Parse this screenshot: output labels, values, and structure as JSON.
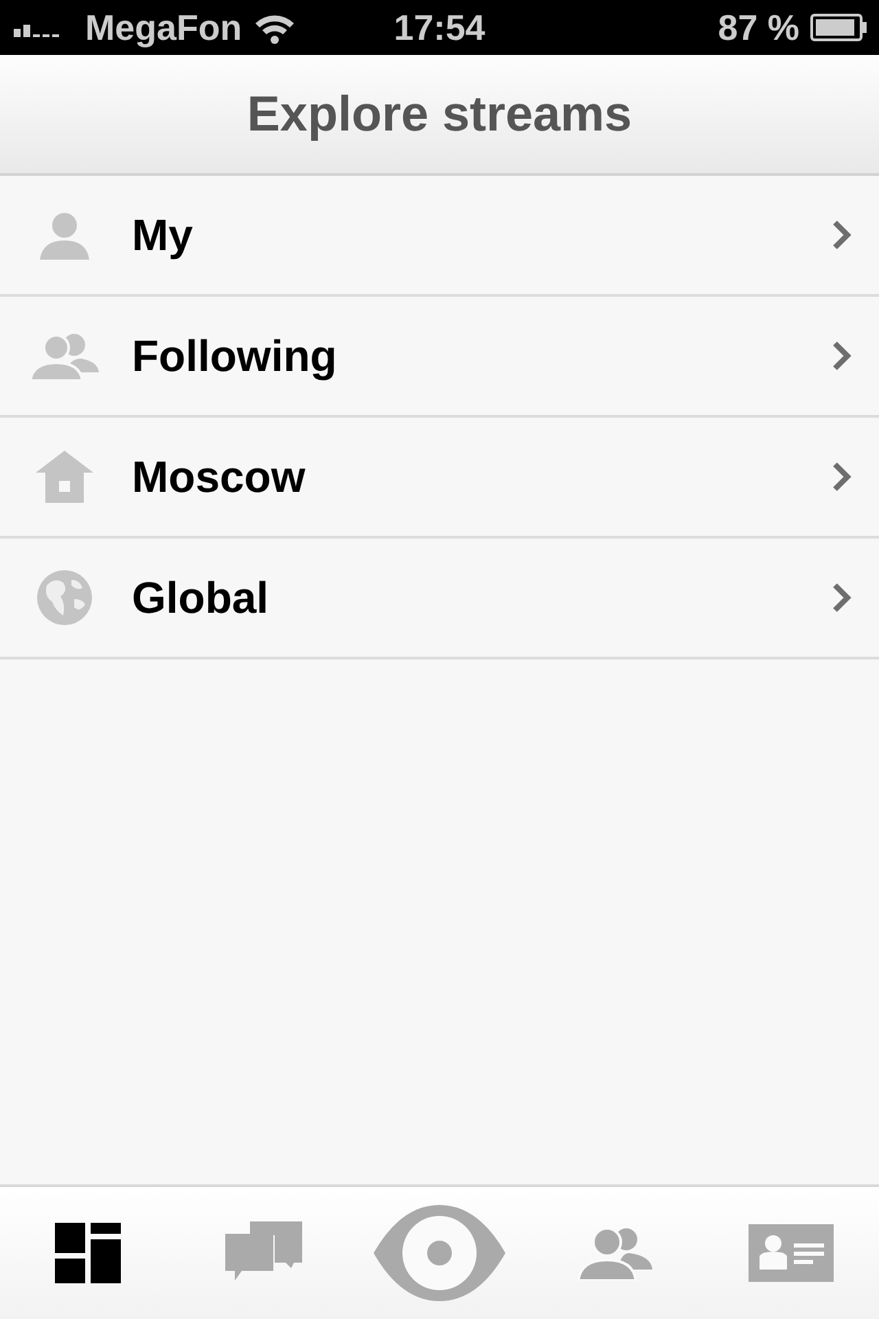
{
  "status_bar": {
    "carrier": "MegaFon",
    "time": "17:54",
    "battery": "87 %"
  },
  "title": "Explore streams",
  "items": [
    {
      "kind": "person",
      "label": "My"
    },
    {
      "kind": "people",
      "label": "Following"
    },
    {
      "kind": "home",
      "label": "Moscow"
    },
    {
      "kind": "globe",
      "label": "Global"
    }
  ],
  "tabs": [
    {
      "kind": "dashboard",
      "selected": true
    },
    {
      "kind": "chat",
      "selected": false
    },
    {
      "kind": "eye",
      "selected": false
    },
    {
      "kind": "people",
      "selected": false
    },
    {
      "kind": "card",
      "selected": false
    }
  ]
}
